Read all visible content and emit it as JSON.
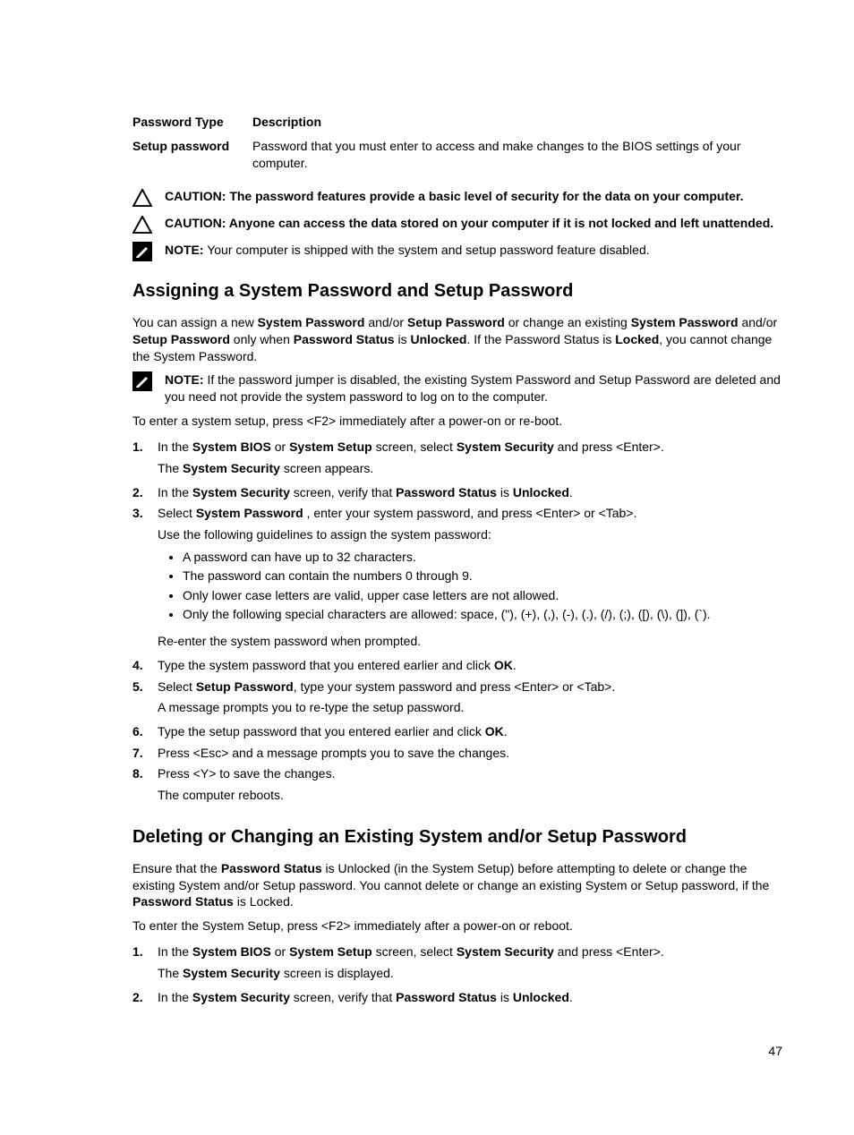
{
  "table": {
    "headers": {
      "col1": "Password Type",
      "col2": "Description"
    },
    "row": {
      "label": "Setup password",
      "desc": "Password that you must enter to access and make changes to the BIOS settings of your computer."
    }
  },
  "notices": {
    "caution1": {
      "label": "CAUTION:",
      "text": " The password features provide a basic level of security for the data on your computer."
    },
    "caution2": {
      "label": "CAUTION:",
      "text": " Anyone can access the data stored on your computer if it is not locked and left unattended."
    },
    "note1": {
      "label": "NOTE:",
      "text": " Your computer is shipped with the system and setup password feature disabled."
    },
    "note2": {
      "label": "NOTE:",
      "text": " If the password jumper is disabled, the existing System Password and Setup Password are deleted and you need not provide the system password to log on to the computer."
    }
  },
  "section1": {
    "heading": "Assigning a System Password and Setup Password",
    "intro": {
      "p1a": "You can assign a new ",
      "p1b": "System Password",
      "p1c": " and/or ",
      "p1d": "Setup Password",
      "p1e": " or change an existing ",
      "p1f": "System Password",
      "p1g": " and/or ",
      "p1h": "Setup Password",
      "p1i": " only when ",
      "p1j": "Password Status",
      "p1k": " is ",
      "p1l": "Unlocked",
      "p1m": ". If the Password Status is ",
      "p1n": "Locked",
      "p1o": ", you cannot change the System Password."
    },
    "pre_steps": "To enter a system setup, press <F2> immediately after a power-on or re-boot.",
    "steps": {
      "s1": {
        "num": "1.",
        "a": "In the ",
        "b": "System BIOS",
        "c": " or ",
        "d": "System Setup",
        "e": " screen, select ",
        "f": "System Security",
        "g": " and press <Enter>.",
        "h": "The ",
        "i": "System Security",
        "j": " screen appears."
      },
      "s2": {
        "num": "2.",
        "a": "In the ",
        "b": "System Security",
        "c": " screen, verify that ",
        "d": "Password Status",
        "e": " is ",
        "f": "Unlocked",
        "g": "."
      },
      "s3": {
        "num": "3.",
        "a": "Select ",
        "b": "System Password",
        "c": " , enter your system password, and press <Enter> or <Tab>.",
        "d": "Use the following guidelines to assign the system password:",
        "bullets": {
          "b1": "A password can have up to 32 characters.",
          "b2": "The password can contain the numbers 0 through 9.",
          "b3": "Only lower case letters are valid, upper case letters are not allowed.",
          "b4": "Only the following special characters are allowed: space, (\"), (+), (,), (-), (.), (/), (;), ([), (\\), (]), (`)."
        },
        "e": "Re-enter the system password when prompted."
      },
      "s4": {
        "num": "4.",
        "a": "Type the system password that you entered earlier and click ",
        "b": "OK",
        "c": "."
      },
      "s5": {
        "num": "5.",
        "a": "Select ",
        "b": "Setup Password",
        "c": ", type your system password and press <Enter> or <Tab>.",
        "d": "A message prompts you to re-type the setup password."
      },
      "s6": {
        "num": "6.",
        "a": "Type the setup password that you entered earlier and click ",
        "b": "OK",
        "c": "."
      },
      "s7": {
        "num": "7.",
        "a": "Press <Esc> and a message prompts you to save the changes."
      },
      "s8": {
        "num": "8.",
        "a": "Press <Y> to save the changes.",
        "b": "The computer reboots."
      }
    }
  },
  "section2": {
    "heading": "Deleting or Changing an Existing System and/or Setup Password",
    "intro": {
      "a": "Ensure that the ",
      "b": "Password Status",
      "c": " is Unlocked (in the System Setup) before attempting to delete or change the existing System and/or Setup password. You cannot delete or change an existing System or Setup password, if the ",
      "d": "Password Status",
      "e": " is Locked."
    },
    "pre_steps": "To enter the System Setup, press <F2> immediately after a power-on or reboot.",
    "steps": {
      "s1": {
        "num": "1.",
        "a": "In the ",
        "b": "System BIOS",
        "c": " or ",
        "d": "System Setup",
        "e": " screen, select ",
        "f": "System Security",
        "g": " and press <Enter>.",
        "h": "The ",
        "i": "System Security",
        "j": " screen is displayed."
      },
      "s2": {
        "num": "2.",
        "a": "In the ",
        "b": "System Security",
        "c": " screen, verify that ",
        "d": "Password Status",
        "e": " is ",
        "f": "Unlocked",
        "g": "."
      }
    }
  },
  "page_number": "47"
}
